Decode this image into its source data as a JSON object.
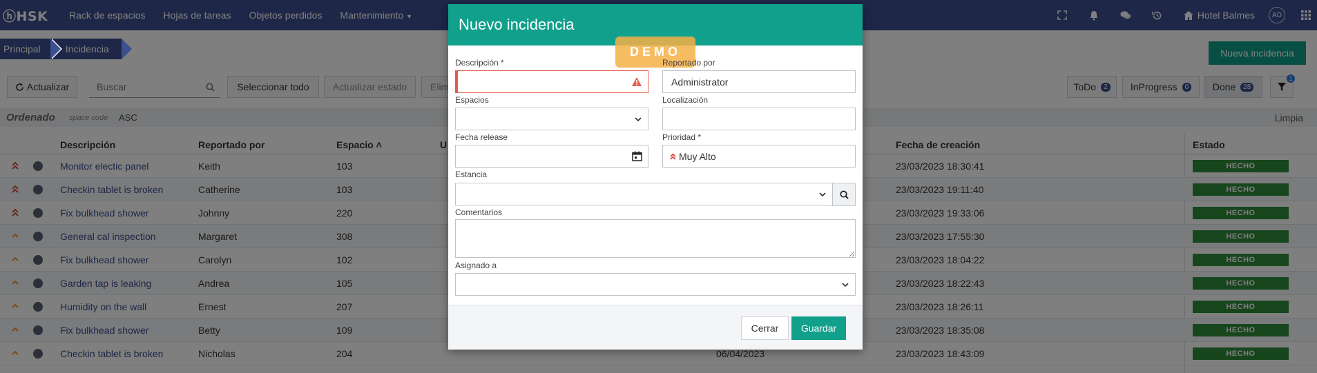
{
  "nav": {
    "logo": "ⓗHSK",
    "items": [
      "Rack de espacios",
      "Hojas de tareas",
      "Objetos perdidos",
      "Mantenimiento"
    ],
    "hotel": "Hotel Balmes",
    "avatar": "AD"
  },
  "breadcrumb": [
    "Principal",
    "Incidencia"
  ],
  "new_incidence_label": "Nueva incidencia",
  "toolbar": {
    "refresh": "Actualizar",
    "search_placeholder": "Buscar",
    "select_all": "Seleccionar todo",
    "update_status": "Actualizar estado",
    "delete_partial": "Elim",
    "filters": [
      {
        "label": "ToDo",
        "count": "2"
      },
      {
        "label": "InProgress",
        "count": "0"
      },
      {
        "label": "Done",
        "count": "28"
      }
    ],
    "filter_count": "1"
  },
  "order": {
    "label": "Ordenado",
    "field": "space code",
    "dir": "ASC",
    "clear": "Limpia"
  },
  "table": {
    "headers": {
      "desc": "Descripción",
      "reported": "Reportado por",
      "space": "Espacio ˄",
      "partial": "U",
      "created": "Fecha de creación",
      "status": "Estado"
    },
    "rows": [
      {
        "prio": "very-high",
        "desc": "Monitor electic panel",
        "reported": "Keith",
        "space": "103",
        "created": "23/03/2023 18:30:41",
        "status": "HECHO"
      },
      {
        "prio": "very-high",
        "desc": "Checkin tablet is broken",
        "reported": "Catherine",
        "space": "103",
        "created": "23/03/2023 19:11:40",
        "status": "HECHO"
      },
      {
        "prio": "very-high",
        "desc": "Fix bulkhead shower",
        "reported": "Johnny",
        "space": "220",
        "created": "23/03/2023 19:33:06",
        "status": "HECHO"
      },
      {
        "prio": "high",
        "desc": "General cal inspection",
        "reported": "Margaret",
        "space": "308",
        "created": "23/03/2023 17:55:30",
        "status": "HECHO"
      },
      {
        "prio": "high",
        "desc": "Fix bulkhead shower",
        "reported": "Carolyn",
        "space": "102",
        "created": "23/03/2023 18:04:22",
        "status": "HECHO"
      },
      {
        "prio": "high",
        "desc": "Garden tap is leaking",
        "reported": "Andrea",
        "space": "105",
        "created": "23/03/2023 18:22:43",
        "status": "HECHO"
      },
      {
        "prio": "high",
        "desc": "Humidity on the wall",
        "reported": "Ernest",
        "space": "207",
        "created": "23/03/2023 18:26:11",
        "status": "HECHO"
      },
      {
        "prio": "high",
        "desc": "Fix bulkhead shower",
        "reported": "Betty",
        "space": "109",
        "created": "23/03/2023 18:35:08",
        "status": "HECHO"
      },
      {
        "prio": "high",
        "desc": "Checkin tablet is broken",
        "reported": "Nicholas",
        "space": "204",
        "extra": "06/04/2023",
        "created": "23/03/2023 18:43:09",
        "status": "HECHO"
      }
    ]
  },
  "modal": {
    "title": "Nuevo incidencia",
    "demo": "DEMO",
    "labels": {
      "desc": "Descripción *",
      "reported": "Reportado por",
      "spaces": "Espacios",
      "location": "Localización",
      "release": "Fecha release",
      "priority": "Prioridad *",
      "stay": "Estancia",
      "comments": "Comentarios",
      "assigned": "Asignado a"
    },
    "values": {
      "desc": "",
      "reported": "Administrator",
      "spaces": "",
      "location": "",
      "release": "",
      "priority": "Muy Alto",
      "stay": "",
      "comments": "",
      "assigned": ""
    },
    "close": "Cerrar",
    "save": "Guardar"
  }
}
